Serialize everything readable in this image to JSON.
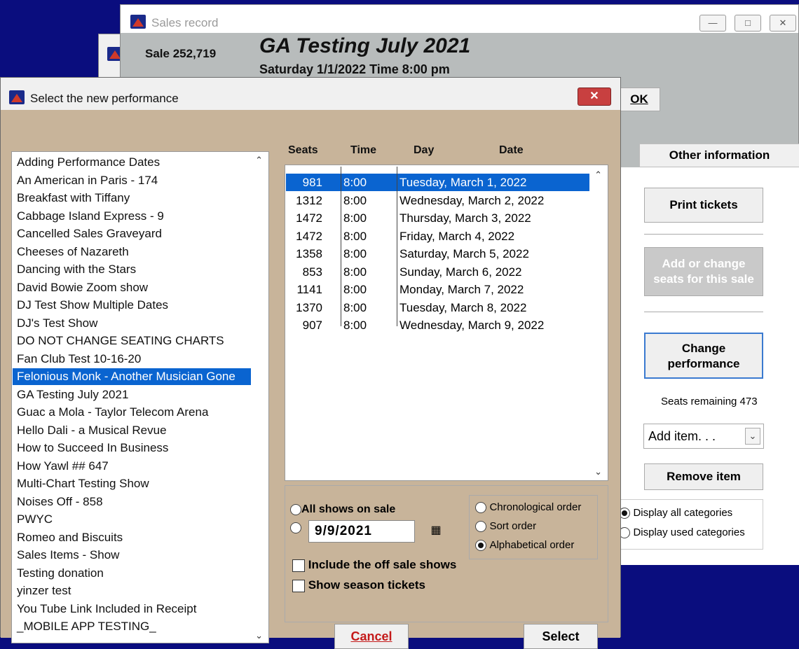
{
  "sales_window": {
    "title": "Sales record",
    "sale_number": "Sale 252,719",
    "event_title": "GA Testing July 2021",
    "event_date": "Saturday 1/1/2022  Time 8:00 pm",
    "ok_label": "OK",
    "tab_other_info": "Other information",
    "print_tickets": "Print tickets",
    "add_change_seats_1": "Add or change",
    "add_change_seats_2": "seats for this sale",
    "change_perf_1": "Change",
    "change_perf_2": "performance",
    "seats_remaining": "Seats remaining 473",
    "add_item": "Add item. . .",
    "remove_item": "Remove item",
    "display_all": "Display all categories",
    "display_used": "Display used categories"
  },
  "dialog": {
    "title": "Select the new performance",
    "close_label": "✕",
    "performances": [
      "Adding Performance Dates",
      "An American in Paris - 174",
      "Breakfast with Tiffany",
      "Cabbage Island Express - 9",
      "Cancelled Sales Graveyard",
      "Cheeses of Nazareth",
      "Dancing with the Stars",
      "David Bowie Zoom show",
      "DJ Test Show Multiple Dates",
      "DJ's Test Show",
      "DO NOT CHANGE SEATING CHARTS",
      "Fan Club Test 10-16-20",
      "Felonious Monk - Another Musician Gone",
      "GA Testing July 2021",
      "Guac a Mola - Taylor Telecom Arena",
      "Hello Dali - a Musical Revue",
      "How to Succeed In Business",
      "How Yawl ## 647",
      "Multi-Chart Testing Show",
      "Noises Off - 858",
      "PWYC",
      "Romeo and Biscuits",
      "Sales Items - Show",
      "Testing donation",
      "yinzer test",
      "You Tube Link Included in Receipt",
      "_MOBILE APP TESTING_"
    ],
    "selected_performance_index": 12,
    "columns": {
      "seats": "Seats",
      "time": "Time",
      "day": "Day",
      "date": "Date"
    },
    "dates": [
      {
        "seats": "981",
        "time": "8:00",
        "date": "Tuesday, March 1, 2022"
      },
      {
        "seats": "1312",
        "time": "8:00",
        "date": "Wednesday, March 2, 2022"
      },
      {
        "seats": "1472",
        "time": "8:00",
        "date": "Thursday, March 3, 2022"
      },
      {
        "seats": "1472",
        "time": "8:00",
        "date": "Friday, March 4, 2022"
      },
      {
        "seats": "1358",
        "time": "8:00",
        "date": "Saturday, March 5, 2022"
      },
      {
        "seats": "853",
        "time": "8:00",
        "date": "Sunday, March 6, 2022"
      },
      {
        "seats": "1141",
        "time": "8:00",
        "date": "Monday, March 7, 2022"
      },
      {
        "seats": "1370",
        "time": "8:00",
        "date": "Tuesday, March 8, 2022"
      },
      {
        "seats": "907",
        "time": "8:00",
        "date": "Wednesday, March 9, 2022"
      }
    ],
    "selected_date_index": 0,
    "all_shows_label": "All shows on sale",
    "date_value": "9/9/2021",
    "chrono_label": "Chronological order",
    "sort_label": "Sort order",
    "alpha_label": "Alphabetical order",
    "include_off_sale": "Include the off sale shows",
    "show_season": "Show season tickets",
    "cancel_label": "Cancel",
    "select_label": "Select"
  }
}
